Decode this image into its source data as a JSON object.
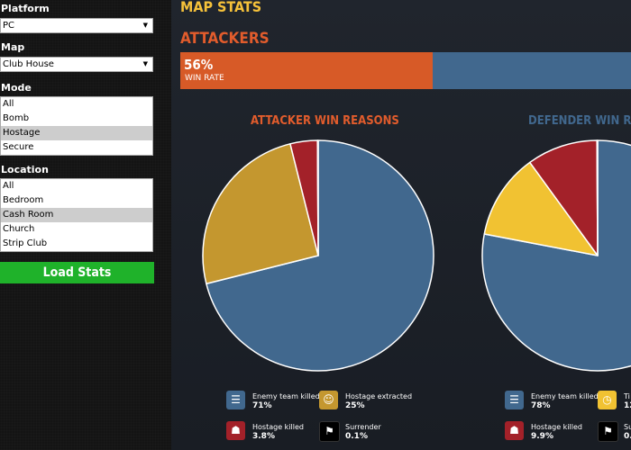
{
  "sidebar": {
    "platform": {
      "label": "Platform",
      "value": "PC"
    },
    "map": {
      "label": "Map",
      "value": "Club House"
    },
    "mode": {
      "label": "Mode",
      "options": [
        "All",
        "Bomb",
        "Hostage",
        "Secure"
      ],
      "selected": "Hostage"
    },
    "location": {
      "label": "Location",
      "options": [
        "All",
        "Bedroom",
        "Cash Room",
        "Church",
        "Strip Club"
      ],
      "selected": "Cash Room"
    },
    "load_button": "Load Stats"
  },
  "main": {
    "title": "MAP STATS",
    "section": "ATTACKERS",
    "win_rate": {
      "value": "56%",
      "label": "WIN RATE",
      "fraction": 0.56
    }
  },
  "colors": {
    "attacker": "#d75a27",
    "defender": "#41688e",
    "title_yellow": "#f6c23a",
    "enemy_killed": "#41688e",
    "hostage_extracted": "#c4972f",
    "hostage_killed": "#a32129",
    "surrender": "#ffffff",
    "timer": "#f1c232"
  },
  "chart_data": [
    {
      "type": "pie",
      "title": "ATTACKER WIN REASONS",
      "slices": [
        {
          "label": "Enemy team killed",
          "value": 71,
          "display": "71%",
          "color": "#41688e",
          "icon": "enemy-killed-icon"
        },
        {
          "label": "Hostage extracted",
          "value": 25,
          "display": "25%",
          "color": "#c4972f",
          "icon": "smiley-icon"
        },
        {
          "label": "Hostage killed",
          "value": 3.8,
          "display": "3.8%",
          "color": "#a32129",
          "icon": "hostage-killed-icon"
        },
        {
          "label": "Surrender",
          "value": 0.1,
          "display": "0.1%",
          "color": "#ffffff",
          "icon": "flag-icon"
        }
      ]
    },
    {
      "type": "pie",
      "title": "DEFENDER WIN R",
      "slices": [
        {
          "label": "Enemy team killed",
          "value": 78,
          "display": "78%",
          "color": "#41688e",
          "icon": "enemy-killed-icon"
        },
        {
          "label": "Ti",
          "value": 12,
          "display": "12",
          "color": "#f1c232",
          "icon": "timer-icon"
        },
        {
          "label": "Hostage killed",
          "value": 9.9,
          "display": "9.9%",
          "color": "#a32129",
          "icon": "hostage-killed-icon"
        },
        {
          "label": "Su",
          "value": 0.1,
          "display": "0.",
          "color": "#ffffff",
          "icon": "flag-icon"
        }
      ]
    }
  ]
}
